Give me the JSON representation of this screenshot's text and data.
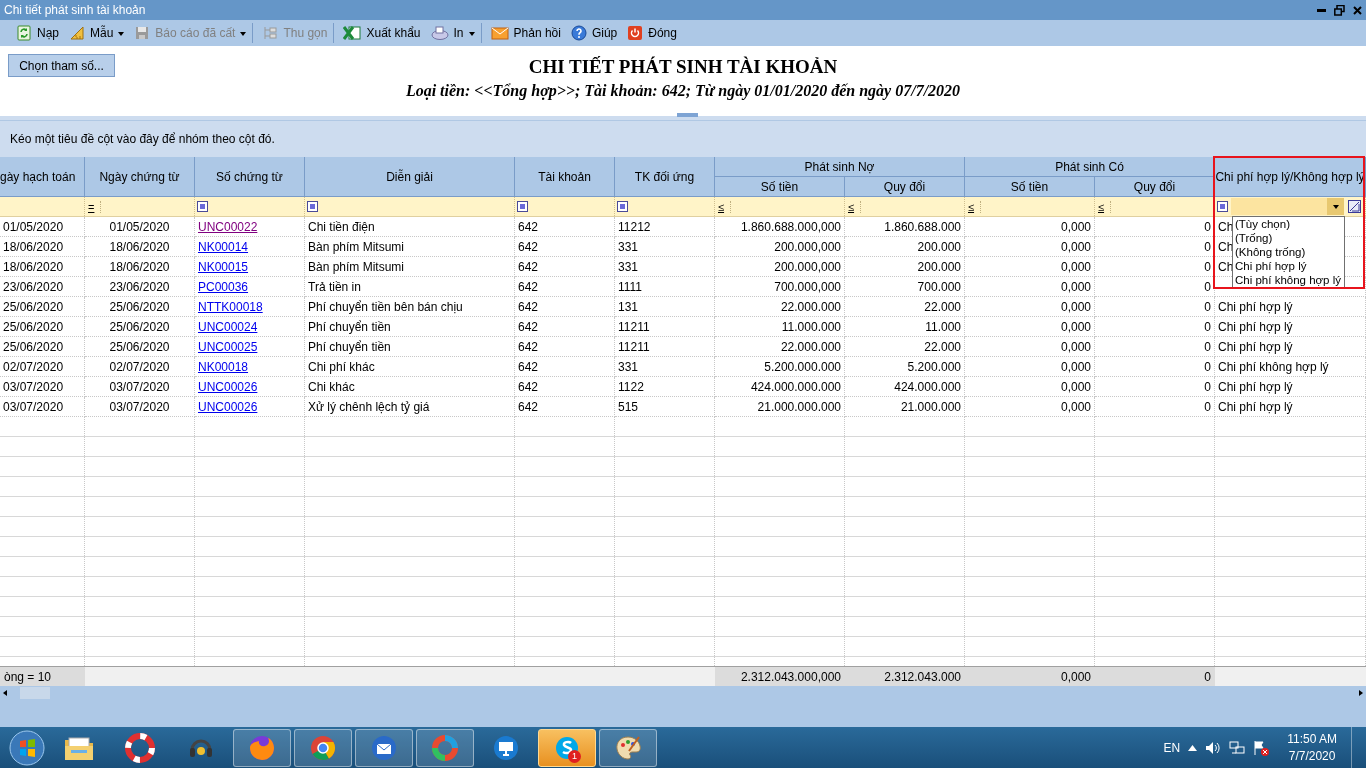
{
  "window": {
    "title": "Chi tiết phát sinh tài khoản"
  },
  "toolbar": [
    {
      "label": "Nạp",
      "disabled": false,
      "dropdown": false,
      "separator_after": false
    },
    {
      "label": "Mẫu",
      "disabled": false,
      "dropdown": true,
      "separator_after": false
    },
    {
      "label": "Báo cáo đã cất",
      "disabled": true,
      "dropdown": true,
      "separator_after": true
    },
    {
      "label": "Thu gọn",
      "disabled": true,
      "dropdown": false,
      "separator_after": true
    },
    {
      "label": "Xuất khẩu",
      "disabled": false,
      "dropdown": false,
      "separator_after": false
    },
    {
      "label": "In",
      "disabled": false,
      "dropdown": true,
      "separator_after": true
    },
    {
      "label": "Phản hồi",
      "disabled": false,
      "dropdown": false,
      "separator_after": false
    },
    {
      "label": "Giúp",
      "disabled": false,
      "dropdown": false,
      "separator_after": false
    },
    {
      "label": "Đóng",
      "disabled": false,
      "dropdown": false,
      "separator_after": false
    }
  ],
  "report": {
    "params_button": "Chọn tham số...",
    "title": "CHI TIẾT PHÁT SINH TÀI KHOẢN",
    "subtitle": "Loại tiền: <<Tổng hợp>>; Tài khoản: 642; Từ ngày 01/01/2020 đến ngày 07/7/2020"
  },
  "group_panel": {
    "hint": "Kéo một tiêu đề cột vào đây để nhóm theo cột đó."
  },
  "table": {
    "header": [
      {
        "label": "gày hạch toán"
      },
      {
        "label": "Ngày chứng từ"
      },
      {
        "label": "Số chứng từ"
      },
      {
        "label": "Diễn giải"
      },
      {
        "label": "Tài khoản"
      },
      {
        "label": "TK đối ứng"
      },
      {
        "group": "Phát sinh Nợ",
        "children": [
          {
            "label": "Số tiền"
          },
          {
            "label": "Quy đổi"
          }
        ]
      },
      {
        "group": "Phát sinh Có",
        "children": [
          {
            "label": "Số tiền"
          },
          {
            "label": "Quy đổi"
          }
        ]
      },
      {
        "label": "Chi phí hợp lý/Không hợp lý",
        "highlighted": true
      }
    ],
    "filters": [
      {
        "kind": "empty"
      },
      {
        "kind": "operator",
        "symbol": "="
      },
      {
        "kind": "square"
      },
      {
        "kind": "square"
      },
      {
        "kind": "square"
      },
      {
        "kind": "square"
      },
      {
        "kind": "operator",
        "symbol": "≤"
      },
      {
        "kind": "operator",
        "symbol": "≤"
      },
      {
        "kind": "operator",
        "symbol": "≤"
      },
      {
        "kind": "operator",
        "symbol": "≤"
      },
      {
        "kind": "dropdown",
        "expanded": true,
        "options": [
          "(Tùy chọn)",
          "(Trống)",
          "(Không trống)",
          "Chi phí hợp lý",
          "Chi phí không hợp lý"
        ]
      }
    ],
    "rows": [
      {
        "visited": true,
        "cells": [
          "01/05/2020",
          "01/05/2020",
          "UNC00022",
          "Chi tiền điện",
          "642",
          "11212",
          "1.860.688.000,000",
          "1.860.688.000",
          "0,000",
          "0",
          "Ch"
        ]
      },
      {
        "visited": false,
        "cells": [
          "18/06/2020",
          "18/06/2020",
          "NK00014",
          "Bàn phím Mitsumi",
          "642",
          "331",
          "200.000,000",
          "200.000",
          "0,000",
          "0",
          "Ch"
        ]
      },
      {
        "visited": false,
        "cells": [
          "18/06/2020",
          "18/06/2020",
          "NK00015",
          "Bàn phím Mitsumi",
          "642",
          "331",
          "200.000,000",
          "200.000",
          "0,000",
          "0",
          "Ch"
        ]
      },
      {
        "visited": false,
        "cells": [
          "23/06/2020",
          "23/06/2020",
          "PC00036",
          "Trả tiền in",
          "642",
          "1111",
          "700.000,000",
          "700.000",
          "0,000",
          "0"
        ]
      },
      {
        "visited": false,
        "cells": [
          "25/06/2020",
          "25/06/2020",
          "NTTK00018",
          "Phí chuyển tiền bên bán chịu",
          "642",
          "131",
          "22.000.000",
          "22.000",
          "0,000",
          "0",
          "Chi phí hợp lý"
        ]
      },
      {
        "visited": false,
        "cells": [
          "25/06/2020",
          "25/06/2020",
          "UNC00024",
          "Phí chuyển tiền",
          "642",
          "11211",
          "11.000.000",
          "11.000",
          "0,000",
          "0",
          "Chi phí hợp lý"
        ]
      },
      {
        "visited": false,
        "cells": [
          "25/06/2020",
          "25/06/2020",
          "UNC00025",
          "Phí chuyển tiền",
          "642",
          "11211",
          "22.000.000",
          "22.000",
          "0,000",
          "0",
          "Chi phí hợp lý"
        ]
      },
      {
        "visited": false,
        "cells": [
          "02/07/2020",
          "02/07/2020",
          "NK00018",
          "Chi phí khác",
          "642",
          "331",
          "5.200.000.000",
          "5.200.000",
          "0,000",
          "0",
          "Chi phí không hợp lý"
        ]
      },
      {
        "visited": false,
        "cells": [
          "03/07/2020",
          "03/07/2020",
          "UNC00026",
          "Chi khác",
          "642",
          "1122",
          "424.000.000.000",
          "424.000.000",
          "0,000",
          "0",
          "Chi phí hợp lý"
        ]
      },
      {
        "visited": false,
        "cells": [
          "03/07/2020",
          "03/07/2020",
          "UNC00026",
          "Xử lý chênh lệch tỷ giá",
          "642",
          "515",
          "21.000.000.000",
          "21.000.000",
          "0,000",
          "0",
          "Chi phí hợp lý"
        ]
      }
    ],
    "footer": {
      "count": "òng = 10",
      "totals": [
        "2.312.043.000,000",
        "2.312.043.000",
        "0,000",
        "0"
      ]
    }
  },
  "taskbar": {
    "apps": [
      {
        "running": false,
        "highlighted": false
      },
      {
        "running": false,
        "highlighted": false
      },
      {
        "running": false,
        "highlighted": false
      },
      {
        "running": true,
        "highlighted": false
      },
      {
        "running": true,
        "highlighted": false
      },
      {
        "running": true,
        "highlighted": false
      },
      {
        "running": true,
        "highlighted": false
      },
      {
        "running": false,
        "highlighted": false
      },
      {
        "running": true,
        "highlighted": true,
        "badge": "1"
      },
      {
        "running": true,
        "highlighted": false
      }
    ],
    "language": "EN",
    "time": "11:50 AM",
    "date": "7/7/2020"
  }
}
